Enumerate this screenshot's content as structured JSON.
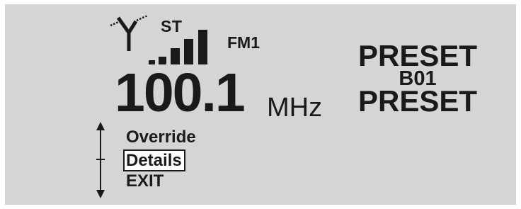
{
  "status": {
    "stereo_label": "ST",
    "band_label": "FM1",
    "signal_bars": 5
  },
  "tuner": {
    "frequency": "100.1",
    "unit": "MHz"
  },
  "preset": {
    "line1": "PRESET",
    "code": "B01",
    "line2": "PRESET"
  },
  "menu": {
    "items": [
      {
        "label": "Override"
      },
      {
        "label": "Details"
      },
      {
        "label": "EXIT"
      }
    ],
    "selected_index": 1
  },
  "icons": {
    "antenna": "antenna-icon",
    "signal": "signal-strength-icon",
    "scroll": "scroll-arrows-icon"
  },
  "colors": {
    "screen_background": "#d5d5d5",
    "text": "#1a1a1a",
    "selection_background": "#ffffff"
  }
}
